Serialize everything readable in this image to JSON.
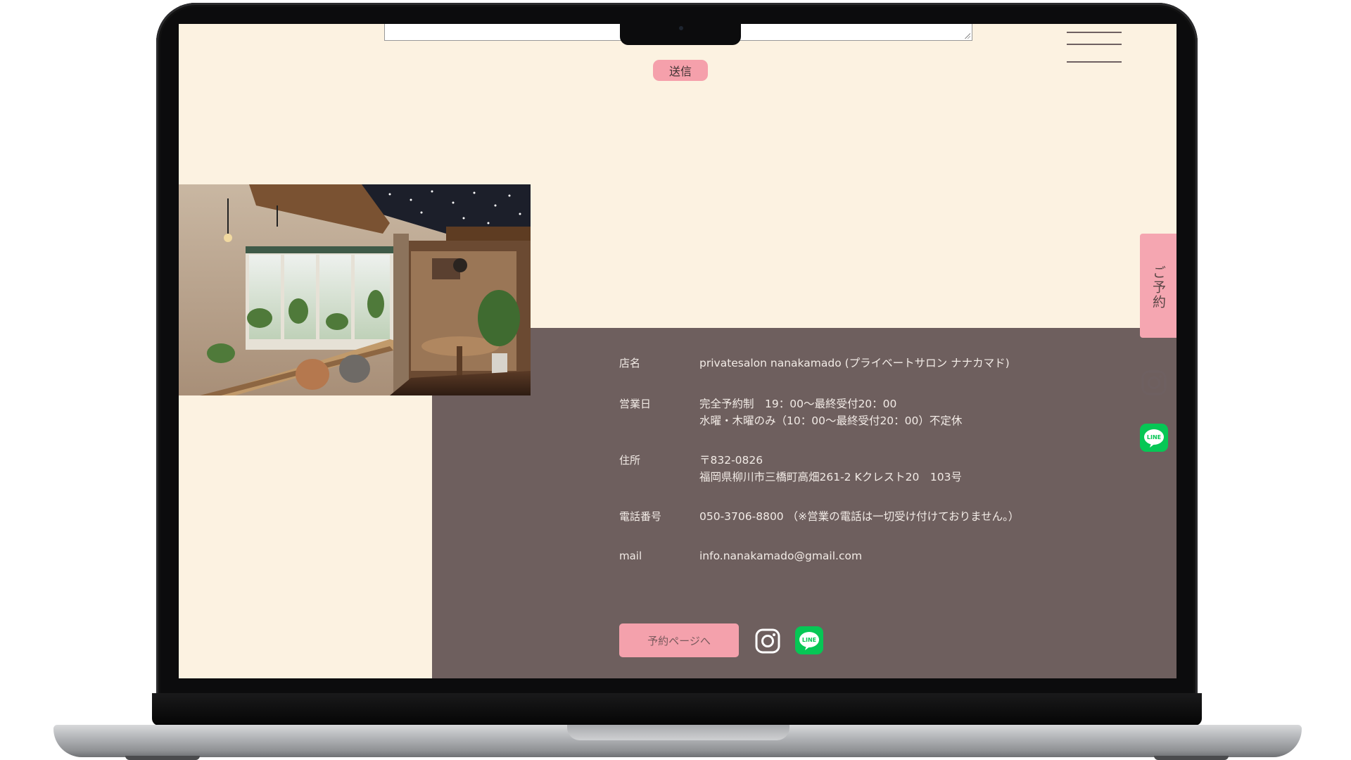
{
  "form": {
    "submit_label": "送信"
  },
  "side": {
    "reserve_tab_label": "ご予約"
  },
  "info": {
    "rows": [
      {
        "label": "店名",
        "lines": [
          "privatesalon nanakamado (プライベートサロン ナナカマド)"
        ]
      },
      {
        "label": "営業日",
        "lines": [
          "完全予約制　19：00〜最終受付20：00",
          "水曜・木曜のみ（10：00〜最終受付20：00）不定休"
        ]
      },
      {
        "label": "住所",
        "lines": [
          "〒832-0826",
          "福岡県柳川市三橋町高畑261-2 Kクレスト20　103号"
        ]
      },
      {
        "label": "電話番号",
        "lines": [
          "050-3706-8800 （※営業の電話は一切受け付けておりません。）"
        ]
      },
      {
        "label": "mail",
        "lines": [
          "info.nanakamado@gmail.com"
        ]
      }
    ]
  },
  "footer": {
    "reserve_page_label": "予約ページへ"
  },
  "colors": {
    "background": "#fcf2e1",
    "panel": "#6e5f5e",
    "accent_pink": "#f5a0ab",
    "line_green": "#06c755"
  },
  "icons": [
    "menu-icon",
    "instagram-icon",
    "line-icon"
  ]
}
